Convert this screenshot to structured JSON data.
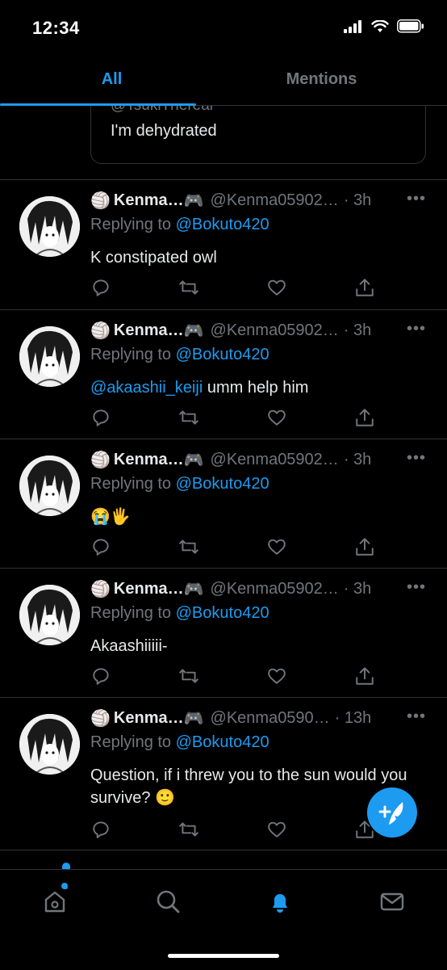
{
  "status_bar": {
    "time": "12:34"
  },
  "tabs": [
    {
      "label": "All",
      "active": true
    },
    {
      "label": "Mentions",
      "active": false
    }
  ],
  "quoted": {
    "handle": "@TsukiThereal",
    "text": "I'm dehydrated"
  },
  "tweets": [
    {
      "emoji_left": "🏐",
      "name": "Kenma…",
      "emoji_right": "🎮",
      "handle": "@Kenma05902…",
      "time": "· 3h",
      "more": "•••",
      "replying_label": "Replying to",
      "replying_to": "@Bokuto420",
      "text_mention": "",
      "text": "K constipated owl"
    },
    {
      "emoji_left": "🏐",
      "name": "Kenma…",
      "emoji_right": "🎮",
      "handle": "@Kenma05902…",
      "time": "· 3h",
      "more": "•••",
      "replying_label": "Replying to",
      "replying_to": "@Bokuto420",
      "text_mention": "@akaashii_keiji",
      "text": " umm help him"
    },
    {
      "emoji_left": "🏐",
      "name": "Kenma…",
      "emoji_right": "🎮",
      "handle": "@Kenma05902…",
      "time": "· 3h",
      "more": "•••",
      "replying_label": "Replying to",
      "replying_to": "@Bokuto420",
      "text_mention": "",
      "text": "😭🖐"
    },
    {
      "emoji_left": "🏐",
      "name": "Kenma…",
      "emoji_right": "🎮",
      "handle": "@Kenma05902…",
      "time": "· 3h",
      "more": "•••",
      "replying_label": "Replying to",
      "replying_to": "@Bokuto420",
      "text_mention": "",
      "text": "Akaashiiiii-"
    },
    {
      "emoji_left": "🏐",
      "name": "Kenma…",
      "emoji_right": "🎮",
      "handle": "@Kenma0590…",
      "time": "· 13h",
      "more": "•••",
      "replying_label": "Replying to",
      "replying_to": "@Bokuto420",
      "text_mention": "",
      "text": "Question, if i threw you to the sun would you survive? 🙂"
    }
  ],
  "icons": {
    "reply": "reply-icon",
    "retweet": "retweet-icon",
    "like": "heart-icon",
    "share": "share-icon",
    "home": "home-icon",
    "search": "search-icon",
    "notifications": "bell-icon",
    "messages": "mail-icon",
    "compose": "compose-tweet-icon"
  },
  "colors": {
    "accent": "#1d9bf0",
    "background": "#000000",
    "muted": "#71767b",
    "divider": "#2f3336"
  }
}
